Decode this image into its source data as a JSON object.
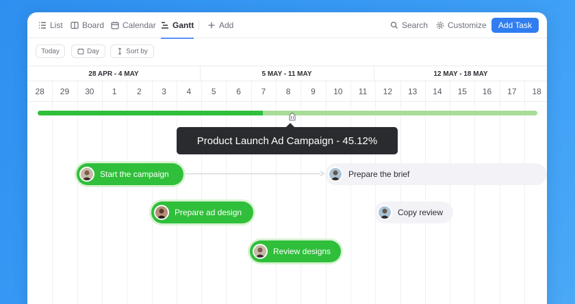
{
  "toolbar": {
    "tabs": [
      {
        "label": "List",
        "icon": "list-icon"
      },
      {
        "label": "Board",
        "icon": "board-icon"
      },
      {
        "label": "Calendar",
        "icon": "calendar-icon"
      },
      {
        "label": "Gantt",
        "icon": "gantt-icon",
        "active": true
      }
    ],
    "add_view_label": "Add",
    "search_label": "Search",
    "customize_label": "Customize",
    "add_task_label": "Add Task"
  },
  "filters": {
    "today_label": "Today",
    "day_label": "Day",
    "sort_label": "Sort by"
  },
  "timeline": {
    "weeks": [
      "28 APR - 4 MAY",
      "5 MAY - 11 MAY",
      "12 MAY - 18 MAY"
    ],
    "days": [
      "28",
      "29",
      "30",
      "1",
      "2",
      "3",
      "4",
      "5",
      "6",
      "7",
      "8",
      "9",
      "10",
      "11",
      "12",
      "13",
      "14",
      "15",
      "16",
      "17",
      "18"
    ]
  },
  "progress": {
    "tooltip": "Product Launch Ad Campaign - 45.12%",
    "fraction": 0.4512
  },
  "tasks": [
    {
      "label": "Start the campaign",
      "status": "done"
    },
    {
      "label": "Prepare the brief",
      "status": "pending"
    },
    {
      "label": "Prepare ad design",
      "status": "done"
    },
    {
      "label": "Copy review",
      "status": "pending"
    },
    {
      "label": "Review designs",
      "status": "done"
    }
  ],
  "colors": {
    "accent": "#2f7df0",
    "done": "#2fbf3a",
    "progress_remaining": "#a8dd97",
    "tooltip_bg": "#2a2b2e"
  }
}
